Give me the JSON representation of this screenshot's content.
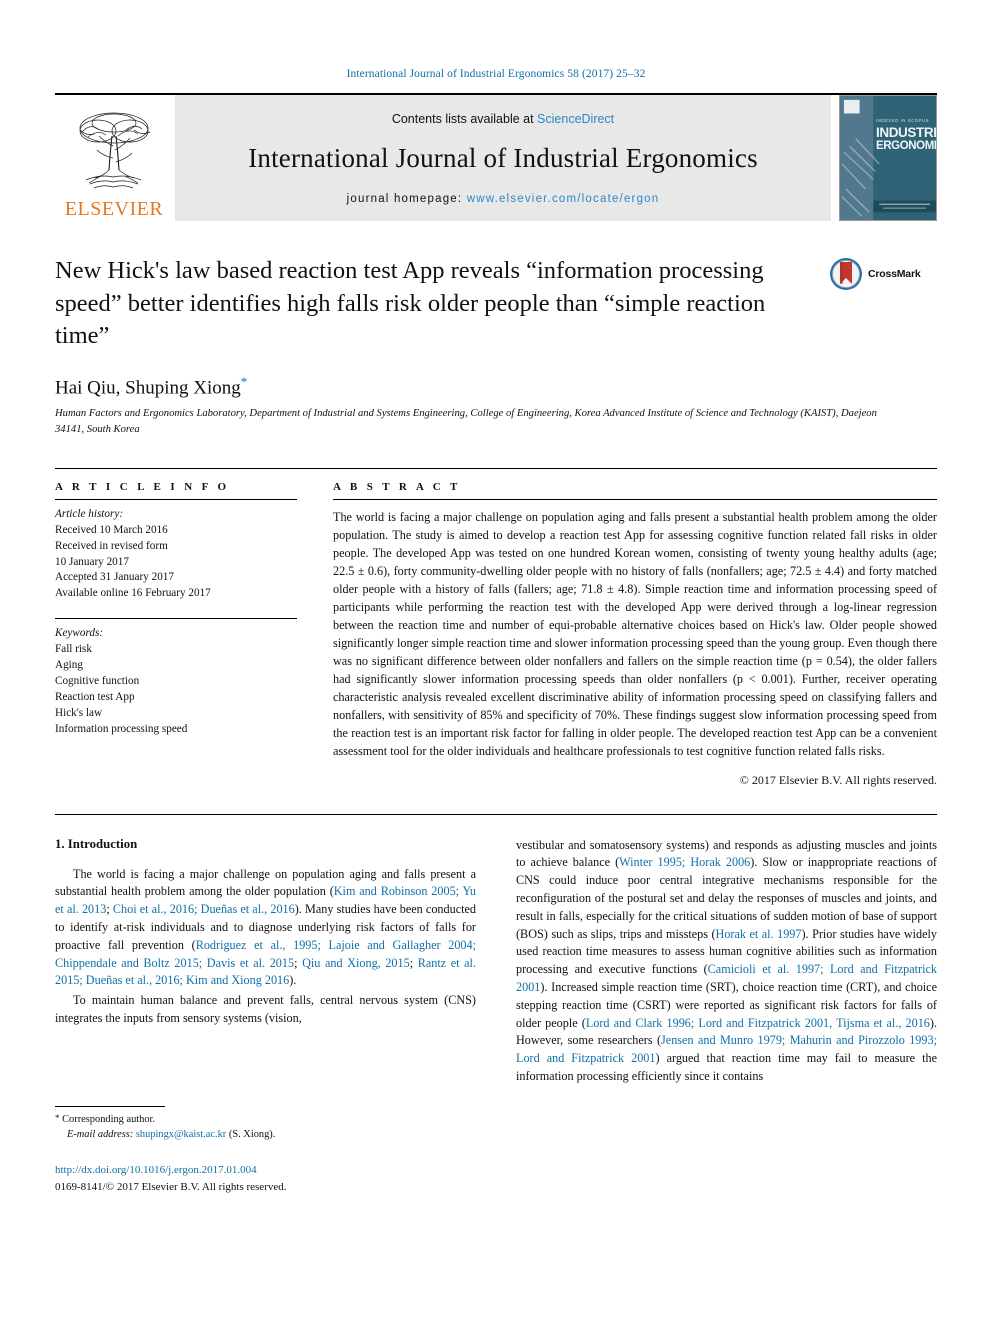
{
  "running_head": "International Journal of Industrial Ergonomics 58 (2017) 25–32",
  "masthead": {
    "publisher": "ELSEVIER",
    "contents_prefix": "Contents lists available at ",
    "contents_link": "ScienceDirect",
    "journal_name": "International Journal of Industrial Ergonomics",
    "homepage_prefix": "journal homepage: ",
    "homepage_url": "www.elsevier.com/locate/ergon",
    "cover_kicker": "INDEXED IN SCOPUS",
    "cover_line1": "INDUSTRIAL",
    "cover_line2": "ERGONOMICS",
    "cover_footer": "AVAILABLE ONLINE AT SCIENCEDIRECT"
  },
  "crossmark": {
    "label": "CrossMark",
    "icon": "crossmark-logo"
  },
  "article": {
    "title": "New Hick's law based reaction test App reveals “information processing speed” better identifies high falls risk older people than “simple reaction time”",
    "authors": "Hai Qiu, Shuping Xiong",
    "corresponding_marker": "*",
    "affiliation": "Human Factors and Ergonomics Laboratory, Department of Industrial and Systems Engineering, College of Engineering, Korea Advanced Institute of Science and Technology (KAIST), Daejeon 34141, South Korea"
  },
  "article_info": {
    "heading": "A R T I C L E   I N F O",
    "history_label": "Article history:",
    "history": [
      "Received 10 March 2016",
      "Received in revised form",
      "10 January 2017",
      "Accepted 31 January 2017",
      "Available online 16 February 2017"
    ],
    "keywords_label": "Keywords:",
    "keywords": [
      "Fall risk",
      "Aging",
      "Cognitive function",
      "Reaction test App",
      "Hick's law",
      "Information processing speed"
    ]
  },
  "abstract": {
    "heading": "A B S T R A C T",
    "text": "The world is facing a major challenge on population aging and falls present a substantial health problem among the older population. The study is aimed to develop a reaction test App for assessing cognitive function related fall risks in older people. The developed App was tested on one hundred Korean women, consisting of twenty young healthy adults (age; 22.5 ± 0.6), forty community-dwelling older people with no history of falls (nonfallers; age; 72.5 ± 4.4) and forty matched older people with a history of falls (fallers; age; 71.8 ± 4.8). Simple reaction time and information processing speed of participants while performing the reaction test with the developed App were derived through a log-linear regression between the reaction time and number of equi-probable alternative choices based on Hick's law. Older people showed significantly longer simple reaction time and slower information processing speed than the young group. Even though there was no significant difference between older nonfallers and fallers on the simple reaction time (p = 0.54), the older fallers had significantly slower information processing speeds than older nonfallers (p < 0.001). Further, receiver operating characteristic analysis revealed excellent discriminative ability of information processing speed on classifying fallers and nonfallers, with sensitivity of 85% and specificity of 70%. These findings suggest slow information processing speed from the reaction test is an important risk factor for falling in older people. The developed reaction test App can be a convenient assessment tool for the older individuals and healthcare professionals to test cognitive function related falls risks.",
    "copyright": "© 2017 Elsevier B.V. All rights reserved."
  },
  "introduction": {
    "section_number_title": "1. Introduction",
    "left_paragraphs": [
      {
        "segments": [
          {
            "t": "The world is facing a major challenge on population aging and falls present a substantial health problem among the older population (",
            "link": false
          },
          {
            "t": "Kim and Robinson 2005; Yu et al. 2013",
            "link": true
          },
          {
            "t": "; ",
            "link": false
          },
          {
            "t": "Choi et al., 2016; Dueñas et al., 2016",
            "link": true
          },
          {
            "t": "). Many studies have been conducted to identify at-risk individuals and to diagnose underlying risk factors of falls for proactive fall prevention (",
            "link": false
          },
          {
            "t": "Rodriguez et al., 1995; Lajoie and Gallagher 2004; Chippendale and Boltz 2015; Davis et al. 2015",
            "link": true
          },
          {
            "t": "; ",
            "link": false
          },
          {
            "t": "Qiu and Xiong, 2015",
            "link": true
          },
          {
            "t": "; ",
            "link": false
          },
          {
            "t": "Rantz et al. 2015; Dueñas et al., 2016; Kim and Xiong 2016",
            "link": true
          },
          {
            "t": ").",
            "link": false
          }
        ]
      },
      {
        "segments": [
          {
            "t": "To maintain human balance and prevent falls, central nervous system (CNS) integrates the inputs from sensory systems (vision,",
            "link": false
          }
        ]
      }
    ],
    "right_paragraphs": [
      {
        "segments": [
          {
            "t": "vestibular and somatosensory systems) and responds as adjusting muscles and joints to achieve balance (",
            "link": false
          },
          {
            "t": "Winter 1995; Horak 2006",
            "link": true
          },
          {
            "t": "). Slow or inappropriate reactions of CNS could induce poor central integrative mechanisms responsible for the reconfiguration of the postural set and delay the responses of muscles and joints, and result in falls, especially for the critical situations of sudden motion of base of support (BOS) such as slips, trips and missteps (",
            "link": false
          },
          {
            "t": "Horak et al. 1997",
            "link": true
          },
          {
            "t": "). Prior studies have widely used reaction time measures to assess human cognitive abilities such as information processing and executive functions (",
            "link": false
          },
          {
            "t": "Camicioli et al. 1997; Lord and Fitzpatrick 2001",
            "link": true
          },
          {
            "t": "). Increased simple reaction time (SRT), choice reaction time (CRT), and choice stepping reaction time (CSRT) were reported as significant risk factors for falls of older people (",
            "link": false
          },
          {
            "t": "Lord and Clark 1996; Lord and Fitzpatrick 2001, Tijsma et al., 2016",
            "link": true
          },
          {
            "t": "). However, some researchers (",
            "link": false
          },
          {
            "t": "Jensen and Munro 1979; Mahurin and Pirozzolo 1993; Lord and Fitzpatrick 2001",
            "link": true
          },
          {
            "t": ") argued that reaction time may fail to measure the information processing efficiently since it contains",
            "link": false
          }
        ]
      }
    ]
  },
  "footnote": {
    "star": "*",
    "corresponding": "Corresponding author.",
    "email_label": "E-mail address:",
    "email": "shupingx@kaist.ac.kr",
    "email_suffix": "(S. Xiong)."
  },
  "footer": {
    "doi": "http://dx.doi.org/10.1016/j.ergon.2017.01.004",
    "issn_line": "0169-8141/© 2017 Elsevier B.V. All rights reserved."
  },
  "colors": {
    "link_blue": "#1070a8",
    "sciencedirect_blue": "#2e87c4",
    "elsevier_orange": "#E87722",
    "band_gray": "#e8e8e8"
  }
}
